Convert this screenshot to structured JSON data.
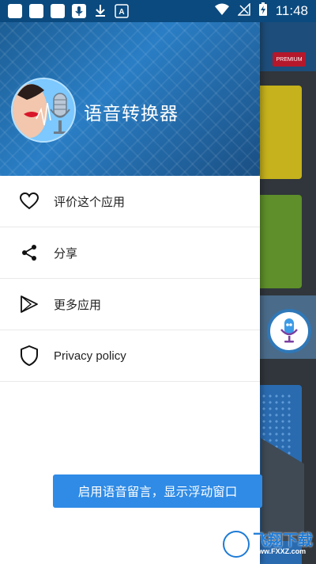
{
  "status_bar": {
    "time": "11:48",
    "icons": [
      "square-notification-icon",
      "square-notification-icon",
      "square-notification-icon",
      "mic-notification-icon",
      "download-icon",
      "text-a-icon",
      "wifi-icon",
      "no-signal-icon",
      "battery-charging-icon"
    ]
  },
  "background_app": {
    "premium_label": "PREMIUM"
  },
  "drawer": {
    "app_title": "语音转换器",
    "menu": [
      {
        "label": "评价这个应用",
        "icon": "heart-icon"
      },
      {
        "label": "分享",
        "icon": "share-icon"
      },
      {
        "label": "更多应用",
        "icon": "play-store-icon"
      },
      {
        "label": "Privacy policy",
        "icon": "shield-icon"
      }
    ]
  },
  "toast": {
    "text": "启用语音留言，显示浮动窗口"
  },
  "watermark": {
    "main": "飞翔下载",
    "sub": "www.FXXZ.com"
  },
  "colors": {
    "status_bar": "#0b4a7e",
    "header_blue": "#2a7ec5",
    "toast_blue": "#2f8be6",
    "premium_red": "#b5172b"
  }
}
